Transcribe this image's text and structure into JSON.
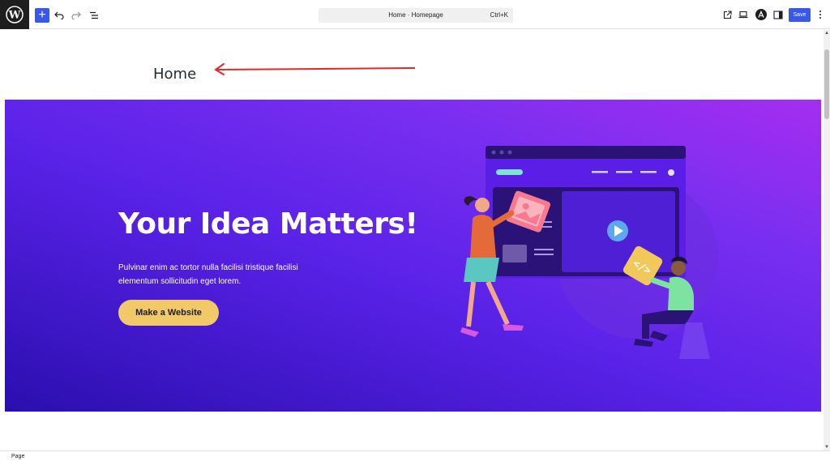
{
  "toolbar": {
    "add_label": "+",
    "document_title": "Home · Homepage",
    "shortcut": "Ctrl+K",
    "save_label": "Save",
    "icons": [
      "wordpress-logo",
      "plus-icon",
      "undo-icon",
      "redo-icon",
      "list-view-icon",
      "external-link-icon",
      "laptop-icon",
      "astra-icon",
      "sidebar-icon",
      "more-vertical-icon"
    ]
  },
  "canvas": {
    "page_title": "Home",
    "hero": {
      "heading": "Your Idea Matters!",
      "text": "Pulvinar enim ac tortor nulla facilisi tristique facilisi elementum sollicitudin eget lorem.",
      "cta_label": "Make a Website"
    }
  },
  "footer": {
    "breadcrumb": "Page"
  },
  "colors": {
    "accent": "#3858e9",
    "annotation_arrow": "#e0282e",
    "cta": "#f1c969",
    "hero_top": "#a52ef0",
    "hero_bottom": "#2a0fae"
  }
}
